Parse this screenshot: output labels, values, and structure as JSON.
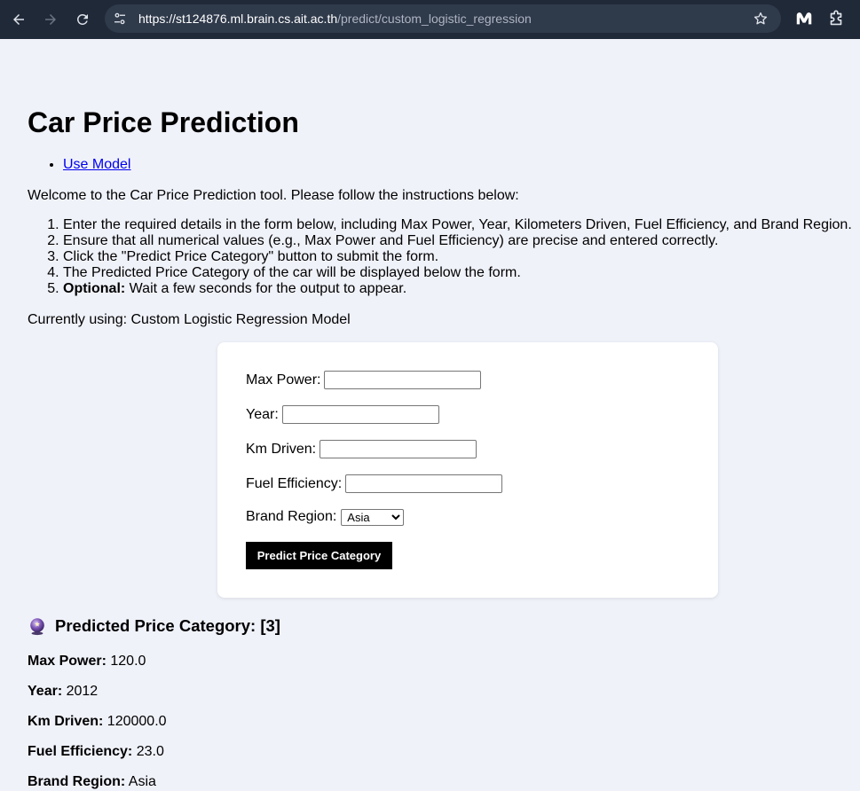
{
  "browser": {
    "url_host": "https://st124876.ml.brain.cs.ait.ac.th",
    "url_path": "/predict/custom_logistic_regression"
  },
  "page": {
    "title": "Car Price Prediction",
    "nav_link": "Use Model",
    "intro": "Welcome to the Car Price Prediction tool. Please follow the instructions below:",
    "instructions": [
      "Enter the required details in the form below, including Max Power, Year, Kilometers Driven, Fuel Efficiency, and Brand Region.",
      "Ensure that all numerical values (e.g., Max Power and Fuel Efficiency) are precise and entered correctly.",
      "Click the \"Predict Price Category\" button to submit the form.",
      "The Predicted Price Category of the car will be displayed below the form."
    ],
    "instruction_5_bold": "Optional:",
    "instruction_5_rest": " Wait a few seconds for the output to appear.",
    "currently_using": "Currently using: Custom Logistic Regression Model"
  },
  "form": {
    "max_power_label": "Max Power:",
    "max_power_value": "",
    "year_label": "Year:",
    "year_value": "",
    "km_driven_label": "Km Driven:",
    "km_driven_value": "",
    "fuel_efficiency_label": "Fuel Efficiency:",
    "fuel_efficiency_value": "",
    "brand_region_label": "Brand Region:",
    "brand_region_selected": "Asia",
    "submit_label": "Predict Price Category"
  },
  "result": {
    "heading": "Predicted Price Category: [3]",
    "max_power_label": "Max Power:",
    "max_power_value": " 120.0",
    "year_label": "Year:",
    "year_value": " 2012",
    "km_driven_label": "Km Driven:",
    "km_driven_value": " 120000.0",
    "fuel_efficiency_label": "Fuel Efficiency:",
    "fuel_efficiency_value": " 23.0",
    "brand_region_label": "Brand Region:",
    "brand_region_value": " Asia"
  },
  "icons": {
    "back": "arrow-left-icon",
    "forward": "arrow-right-icon",
    "reload": "reload-icon",
    "site_info": "tune-icon",
    "bookmark": "star-icon",
    "extension_1": "malwarebytes-icon",
    "extension_2": "puzzle-icon",
    "result": "crystal-ball-icon"
  },
  "colors": {
    "chrome_bg": "#202938",
    "address_bg": "#2f3a4b",
    "page_bg": "#f0f2fa",
    "card_bg": "#ffffff",
    "button_bg": "#000000",
    "link": "#0000ee"
  }
}
